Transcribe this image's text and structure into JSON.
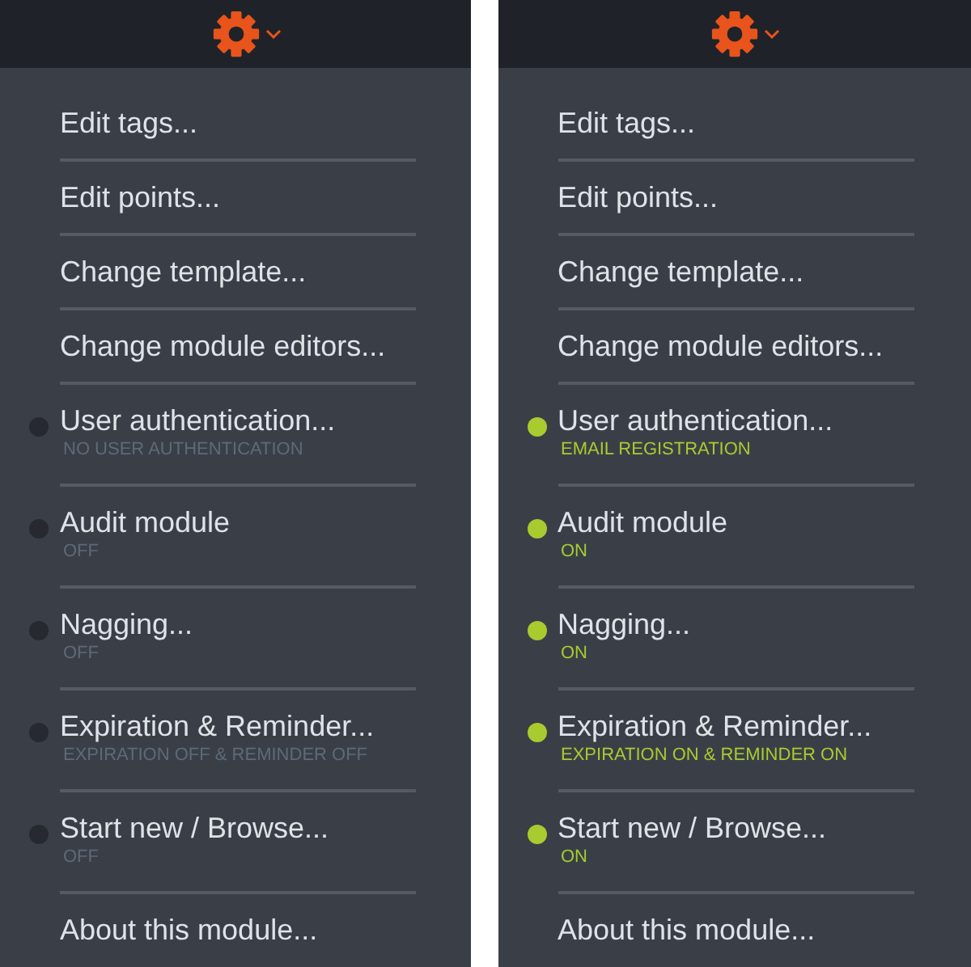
{
  "panels": [
    {
      "items": [
        {
          "label": "Edit tags..."
        },
        {
          "label": "Edit points..."
        },
        {
          "label": "Change template..."
        },
        {
          "label": "Change module editors..."
        },
        {
          "label": "User authentication...",
          "status": "NO USER AUTHENTICATION",
          "on": false
        },
        {
          "label": "Audit module",
          "status": "OFF",
          "on": false
        },
        {
          "label": "Nagging...",
          "status": "OFF",
          "on": false
        },
        {
          "label": "Expiration & Reminder...",
          "status": "EXPIRATION OFF & REMINDER OFF",
          "on": false
        },
        {
          "label": "Start new / Browse...",
          "status": "OFF",
          "on": false
        },
        {
          "label": "About this module..."
        }
      ]
    },
    {
      "items": [
        {
          "label": "Edit tags..."
        },
        {
          "label": "Edit points..."
        },
        {
          "label": "Change template..."
        },
        {
          "label": "Change module editors..."
        },
        {
          "label": "User authentication...",
          "status": "EMAIL REGISTRATION",
          "on": true
        },
        {
          "label": "Audit module",
          "status": "ON",
          "on": true
        },
        {
          "label": "Nagging...",
          "status": "ON",
          "on": true
        },
        {
          "label": "Expiration & Reminder...",
          "status": "EXPIRATION ON & REMINDER ON",
          "on": true
        },
        {
          "label": "Start new / Browse...",
          "status": "ON",
          "on": true
        },
        {
          "label": "About this module..."
        }
      ]
    }
  ]
}
